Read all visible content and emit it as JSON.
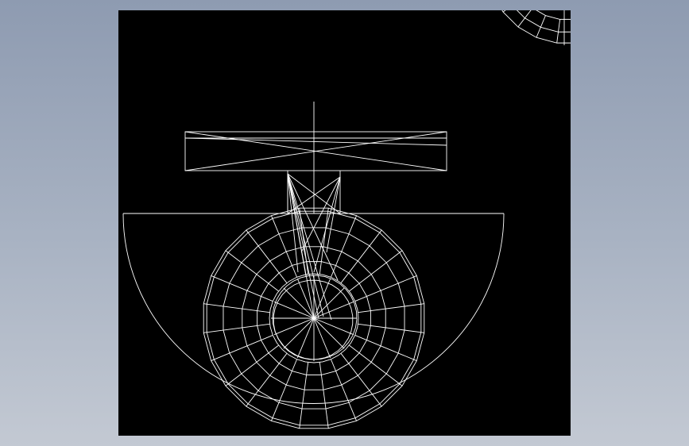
{
  "drawing": {
    "background": "#000000",
    "line_color": "#ffffff",
    "style": "wireframe",
    "desktop_gradient": [
      "#8e9bb1",
      "#c3c9d3"
    ]
  }
}
